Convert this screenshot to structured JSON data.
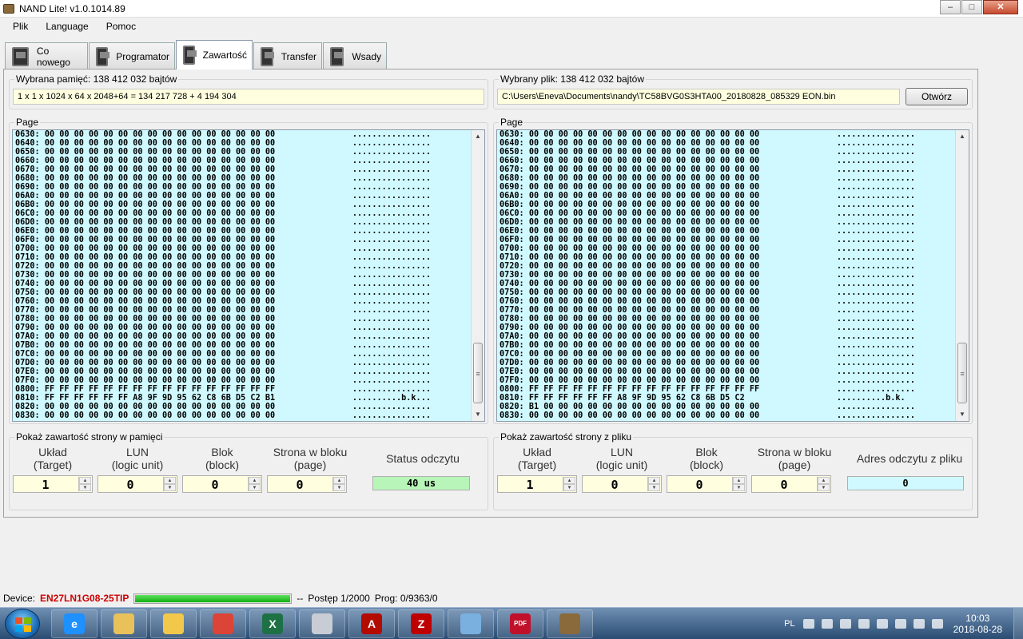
{
  "window": {
    "title": "NAND Lite! v1.0.1014.89"
  },
  "menu": [
    "Plik",
    "Language",
    "Pomoc"
  ],
  "tabs": [
    {
      "label": "Co nowego"
    },
    {
      "label": "Programator"
    },
    {
      "label": "Zawartość"
    },
    {
      "label": "Transfer"
    },
    {
      "label": "Wsady"
    }
  ],
  "left": {
    "memory_label": "Wybrana pamięć:  138 412 032 bajtów",
    "memory_formula": "1 x 1 x 1024 x 64 x 2048+64 =  134 217 728 +  4 194 304",
    "page_label": "Page",
    "controls_label": "Pokaż zawartość strony w pamięci",
    "h_uklad_1": "Układ",
    "h_uklad_2": "(Target)",
    "h_lun_1": "LUN",
    "h_lun_2": "(logic unit)",
    "h_blok_1": "Blok",
    "h_blok_2": "(block)",
    "h_strona_1": "Strona w bloku",
    "h_strona_2": "(page)",
    "h_status": "Status odczytu",
    "uklad": "1",
    "lun": "0",
    "blok": "0",
    "strona": "0",
    "status": "40 us"
  },
  "right": {
    "file_label": "Wybrany plik:  138 412 032 bajtów",
    "file_path": "C:\\Users\\Eneva\\Documents\\nandy\\TC58BVG0S3HTA00_20180828_085329 EON.bin",
    "open_button": "Otwórz",
    "page_label": "Page",
    "controls_label": "Pokaż zawartość strony z pliku",
    "h_uklad_1": "Układ",
    "h_uklad_2": "(Target)",
    "h_lun_1": "LUN",
    "h_lun_2": "(logic unit)",
    "h_blok_1": "Blok",
    "h_blok_2": "(block)",
    "h_strona_1": "Strona w bloku",
    "h_strona_2": "(page)",
    "h_address": "Adres odczytu z pliku",
    "uklad": "1",
    "lun": "0",
    "blok": "0",
    "strona": "0",
    "address": "0"
  },
  "hex": {
    "zero_addresses": [
      "0630",
      "0640",
      "0650",
      "0660",
      "0670",
      "0680",
      "0690",
      "06A0",
      "06B0",
      "06C0",
      "06D0",
      "06E0",
      "06F0",
      "0700",
      "0710",
      "0720",
      "0730",
      "0740",
      "0750",
      "0760",
      "0770",
      "0780",
      "0790",
      "07A0",
      "07B0",
      "07C0",
      "07D0",
      "07E0",
      "07F0"
    ],
    "zero_bytes": "00 00 00 00 00 00 00 00 00 00 00 00 00 00 00 00",
    "zero_ascii": "................",
    "row_0800": {
      "addr": "0800",
      "bytes": "FF FF FF FF FF FF FF FF FF FF FF FF FF FF FF FF",
      "ascii": "................"
    },
    "row_0810_left": {
      "addr": "0810",
      "bytes": "FF FF FF FF FF FF A8 9F 9D 95 62 C8 6B D5 C2 B1",
      "ascii": "..........b.k..."
    },
    "row_0810_right": {
      "addr": "0810",
      "bytes": "FF FF FF FF FF FF A8 9F 9D 95 62 C8 6B D5 C2",
      "ascii": "..........b.k."
    },
    "row_0820_left": {
      "addr": "0820",
      "bytes": "00 00 00 00 00 00 00 00 00 00 00 00 00 00 00 00",
      "ascii": "................"
    },
    "row_0820_right": {
      "addr": "0820",
      "bytes": "B1 00 00 00 00 00 00 00 00 00 00 00 00 00 00 00",
      "ascii": "................"
    },
    "row_0830": {
      "addr": "0830",
      "bytes": "00 00 00 00 00 00 00 00 00 00 00 00 00 00 00 00",
      "ascii": "................"
    }
  },
  "statusbar": {
    "device_label": "Device:",
    "device_name": "EN27LN1G08-25TIP",
    "progress": 1.0,
    "sep": "--",
    "postep": "Postęp 1/2000",
    "prog": "Prog: 0/9363/0"
  },
  "taskbar": {
    "apps": [
      {
        "icon": "internet-explorer-icon",
        "color": "#1e90ff",
        "glyph": "e"
      },
      {
        "icon": "file-explorer-icon",
        "color": "#e8c15a",
        "glyph": ""
      },
      {
        "icon": "outlook-icon",
        "color": "#f2c84b",
        "glyph": ""
      },
      {
        "icon": "chrome-icon",
        "color": "#db4437",
        "glyph": ""
      },
      {
        "icon": "excel-icon",
        "color": "#1e7145",
        "glyph": "X"
      },
      {
        "icon": "calculator-icon",
        "color": "#c8ccd4",
        "glyph": ""
      },
      {
        "icon": "acrobat-icon",
        "color": "#b30b00",
        "glyph": "A"
      },
      {
        "icon": "filezilla-icon",
        "color": "#bf0000",
        "glyph": "Z"
      },
      {
        "icon": "paint-icon",
        "color": "#7ab0e0",
        "glyph": ""
      },
      {
        "icon": "pdf-editor-icon",
        "color": "#c0102a",
        "glyph": "PDF"
      },
      {
        "icon": "nand-lite-icon",
        "color": "#8a6a3a",
        "glyph": ""
      }
    ],
    "lang": "PL",
    "time": "10:03",
    "date": "2018-08-28"
  }
}
